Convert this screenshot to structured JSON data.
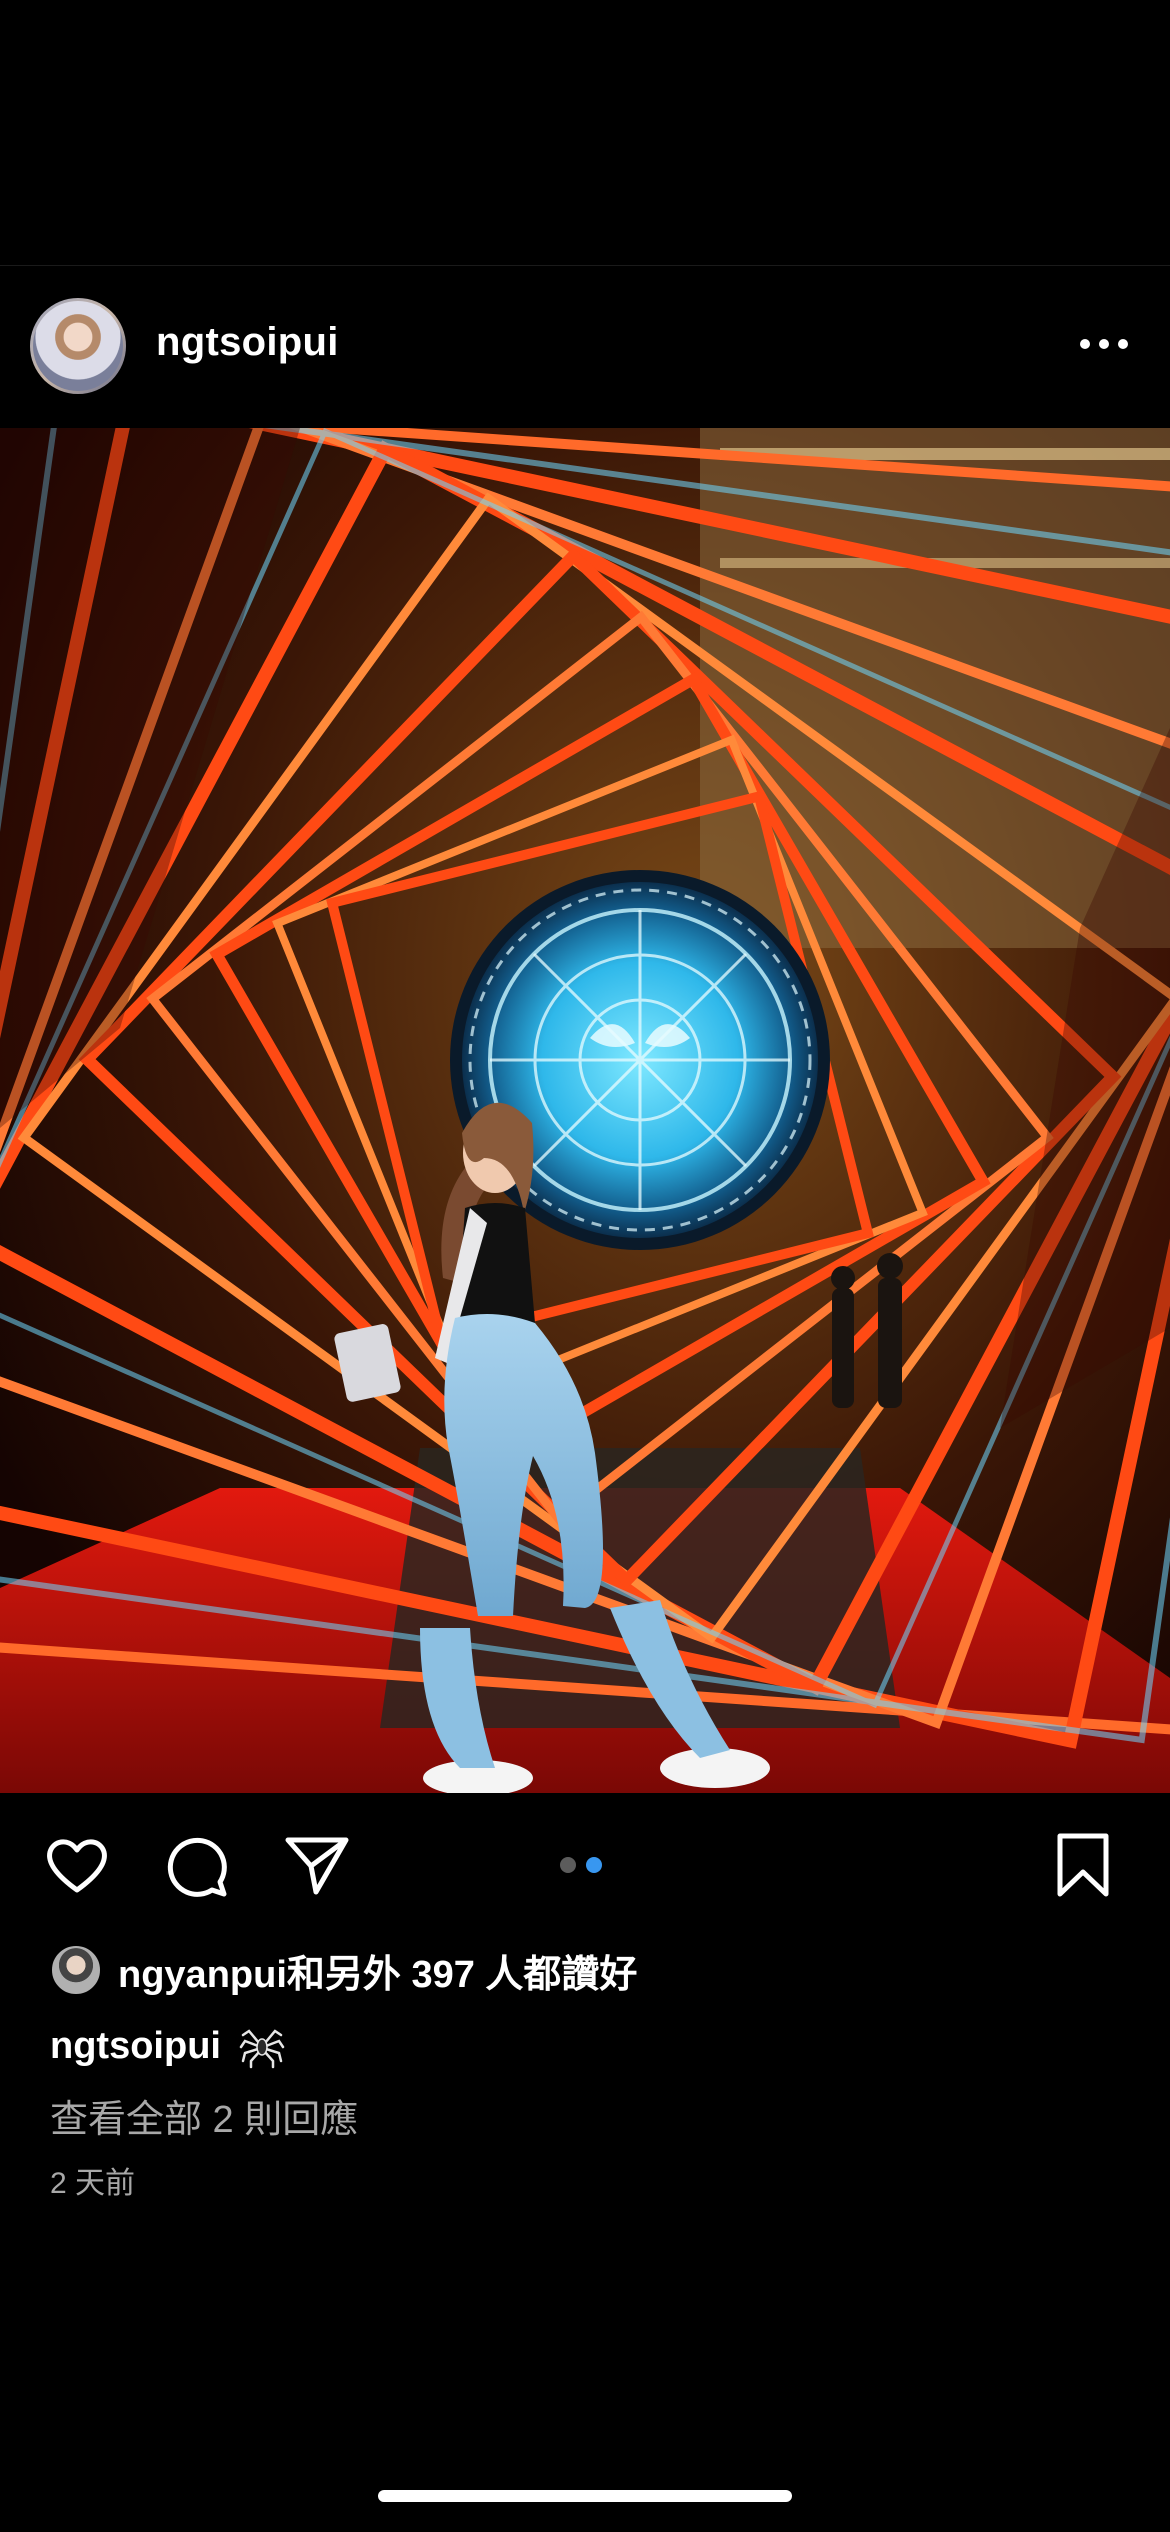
{
  "post": {
    "username": "ngtsoipui",
    "more_icon": "more-horizontal-icon"
  },
  "image": {
    "description_colors": {
      "neon": "#ff5a1f",
      "portal": "#3fc6f2",
      "floor": "#c4120a"
    }
  },
  "actions": {
    "like_icon": "heart-icon",
    "comment_icon": "comment-icon",
    "share_icon": "send-icon",
    "save_icon": "bookmark-icon",
    "carousel": {
      "count": 2,
      "active_index": 1
    }
  },
  "likes": {
    "text": "ngyanpui和另外 397 人都讚好"
  },
  "caption": {
    "username": "ngtsoipui",
    "emoji_icon": "spider-icon"
  },
  "comments": {
    "view_all": "查看全部 2 則回應"
  },
  "timestamp": "2 天前",
  "colors": {
    "background": "#000000",
    "secondary_text": "#a8a8a8",
    "active_dot": "#3897f0"
  }
}
